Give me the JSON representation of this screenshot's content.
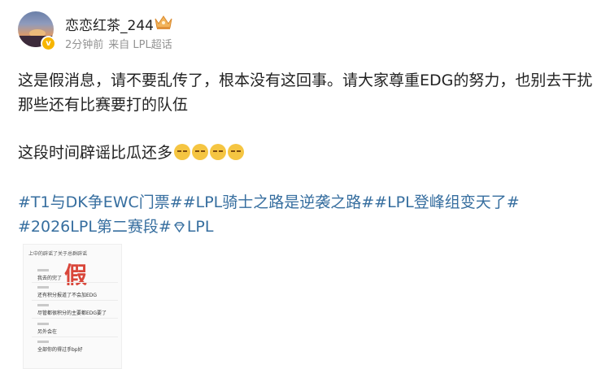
{
  "post": {
    "username": "恋恋红茶_244",
    "time": "2分钟前",
    "source": "来自 LPL超话",
    "verified_badge": "v",
    "paragraph1": "这是假消息，请不要乱传了，根本没有这回事。请大家尊重EDG的努力，也别去干扰那些还有比赛要打的队伍",
    "paragraph2": "这段时间辟谣比瓜还多",
    "emoji_count": 4,
    "emoji_name": "thinking-face-emoji",
    "hashtags": [
      "#T1与DK争EWC门票#",
      "#LPL骑士之路是逆袭之路#",
      "#LPL登峰组变天了#",
      "#2026LPL第二赛段#"
    ],
    "super_topic_label": "LPL",
    "accent_color": "#366e9f"
  },
  "image": {
    "title": "上中的辟谣了关于总群辟谣",
    "big_text": "假",
    "rows": [
      "我去的完了",
      "还有积分报道了不会加EDG",
      "尽管都很积分的主要都EDG要了",
      "另外会在",
      "全部你的得过手bp好"
    ]
  }
}
